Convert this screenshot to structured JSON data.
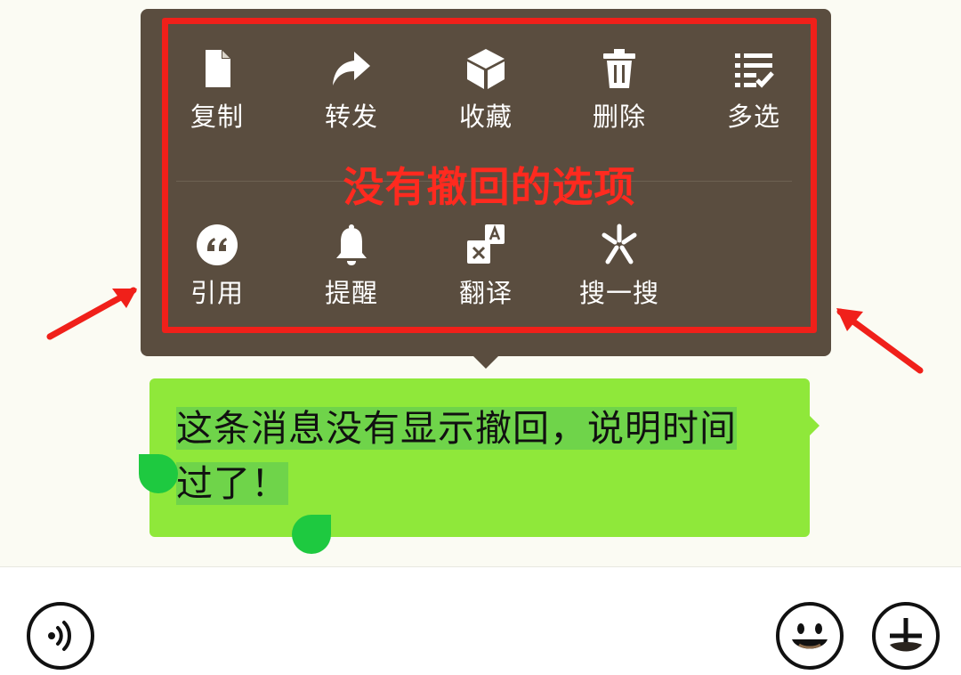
{
  "menu": {
    "row1": [
      {
        "label": "复制",
        "icon": "copy-icon"
      },
      {
        "label": "转发",
        "icon": "forward-icon"
      },
      {
        "label": "收藏",
        "icon": "favorite-icon"
      },
      {
        "label": "删除",
        "icon": "trash-icon"
      },
      {
        "label": "多选",
        "icon": "multi-select-icon"
      }
    ],
    "row2": [
      {
        "label": "引用",
        "icon": "quote-icon"
      },
      {
        "label": "提醒",
        "icon": "bell-icon"
      },
      {
        "label": "翻译",
        "icon": "translate-icon"
      },
      {
        "label": "搜一搜",
        "icon": "search-sparkle-icon"
      }
    ]
  },
  "annotation": {
    "text": "没有撤回的选项",
    "color": "#ff2a1f"
  },
  "message": {
    "line1": "这条消息没有显示撤回，说明时间",
    "line2": "过了！",
    "bubble_color": "#8fe83a"
  },
  "input_bar": {
    "left_icon": "voice-icon",
    "right_icons": [
      "emoji-icon",
      "plus-icon"
    ]
  },
  "colors": {
    "menu_bg": "#5a4d3f",
    "highlight": "#f0201a",
    "page_bg": "#fbfbf3"
  }
}
